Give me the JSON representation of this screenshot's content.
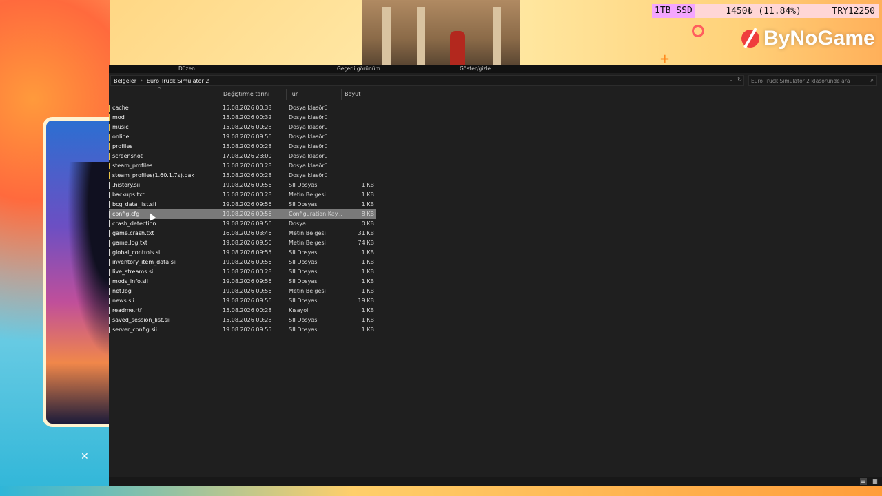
{
  "overlay": {
    "stats": [
      "1TB SSD",
      "1450₺ (11.84%)",
      "TRY12250"
    ],
    "brand": "ByNoGame",
    "close_glyph": "✕"
  },
  "ribbon": {
    "items": [
      "Düzen",
      "Geçerli görünüm",
      "Göster/gizle"
    ]
  },
  "address": {
    "crumbs": [
      "Belgeler",
      "Euro Truck Simulator 2"
    ],
    "separator": "›",
    "dropdown_glyph": "⌄",
    "refresh_glyph": "↻"
  },
  "search": {
    "placeholder": "Euro Truck Simulator 2 klasöründe ara",
    "icon": "search-icon"
  },
  "columns": [
    "Değiştirme tarihi",
    "Tür",
    "Boyut"
  ],
  "sort_caret": "^",
  "files": [
    {
      "name": "cache",
      "date": "15.08.2026 00:33",
      "type": "Dosya klasörü",
      "size": "",
      "kind": "folder"
    },
    {
      "name": "mod",
      "date": "15.08.2026 00:32",
      "type": "Dosya klasörü",
      "size": "",
      "kind": "folder"
    },
    {
      "name": "music",
      "date": "15.08.2026 00:28",
      "type": "Dosya klasörü",
      "size": "",
      "kind": "folder"
    },
    {
      "name": "online",
      "date": "19.08.2026 09:56",
      "type": "Dosya klasörü",
      "size": "",
      "kind": "folder"
    },
    {
      "name": "profiles",
      "date": "15.08.2026 00:28",
      "type": "Dosya klasörü",
      "size": "",
      "kind": "folder"
    },
    {
      "name": "screenshot",
      "date": "17.08.2026 23:00",
      "type": "Dosya klasörü",
      "size": "",
      "kind": "folder"
    },
    {
      "name": "steam_profiles",
      "date": "15.08.2026 00:28",
      "type": "Dosya klasörü",
      "size": "",
      "kind": "folder"
    },
    {
      "name": "steam_profiles(1.60.1.7s).bak",
      "date": "15.08.2026 00:28",
      "type": "Dosya klasörü",
      "size": "",
      "kind": "folder"
    },
    {
      "name": ".history.sii",
      "date": "19.08.2026 09:56",
      "type": "SII Dosyası",
      "size": "1 KB",
      "kind": "file"
    },
    {
      "name": "backups.txt",
      "date": "15.08.2026 00:28",
      "type": "Metin Belgesi",
      "size": "1 KB",
      "kind": "file"
    },
    {
      "name": "bcg_data_list.sii",
      "date": "19.08.2026 09:56",
      "type": "SII Dosyası",
      "size": "1 KB",
      "kind": "file"
    },
    {
      "name": "config.cfg",
      "date": "19.08.2026 09:56",
      "type": "Configuration Kay...",
      "size": "8 KB",
      "kind": "file",
      "selected": true
    },
    {
      "name": "crash_detection",
      "date": "19.08.2026 09:56",
      "type": "Dosya",
      "size": "0 KB",
      "kind": "file"
    },
    {
      "name": "game.crash.txt",
      "date": "16.08.2026 03:46",
      "type": "Metin Belgesi",
      "size": "31 KB",
      "kind": "file"
    },
    {
      "name": "game.log.txt",
      "date": "19.08.2026 09:56",
      "type": "Metin Belgesi",
      "size": "74 KB",
      "kind": "file"
    },
    {
      "name": "global_controls.sii",
      "date": "19.08.2026 09:55",
      "type": "SII Dosyası",
      "size": "1 KB",
      "kind": "file"
    },
    {
      "name": "inventory_item_data.sii",
      "date": "19.08.2026 09:56",
      "type": "SII Dosyası",
      "size": "1 KB",
      "kind": "file"
    },
    {
      "name": "live_streams.sii",
      "date": "15.08.2026 00:28",
      "type": "SII Dosyası",
      "size": "1 KB",
      "kind": "file"
    },
    {
      "name": "mods_info.sii",
      "date": "19.08.2026 09:56",
      "type": "SII Dosyası",
      "size": "1 KB",
      "kind": "file"
    },
    {
      "name": "net.log",
      "date": "19.08.2026 09:56",
      "type": "Metin Belgesi",
      "size": "1 KB",
      "kind": "file"
    },
    {
      "name": "news.sii",
      "date": "19.08.2026 09:56",
      "type": "SII Dosyası",
      "size": "19 KB",
      "kind": "file"
    },
    {
      "name": "readme.rtf",
      "date": "15.08.2026 00:28",
      "type": "Kısayol",
      "size": "1 KB",
      "kind": "file"
    },
    {
      "name": "saved_session_list.sii",
      "date": "15.08.2026 00:28",
      "type": "SII Dosyası",
      "size": "1 KB",
      "kind": "file"
    },
    {
      "name": "server_config.sii",
      "date": "19.08.2026 09:55",
      "type": "SII Dosyası",
      "size": "1 KB",
      "kind": "file"
    }
  ],
  "colors": {
    "folder_marker": "#e8c34a",
    "file_marker": "#d9d9d9",
    "selected_row": "#7a7a7a",
    "window_bg": "#1f1f1f"
  },
  "view_buttons": [
    {
      "name": "details-view-icon",
      "glyph": "☰",
      "active": true
    },
    {
      "name": "large-icons-view-icon",
      "glyph": "▦",
      "active": false
    }
  ]
}
